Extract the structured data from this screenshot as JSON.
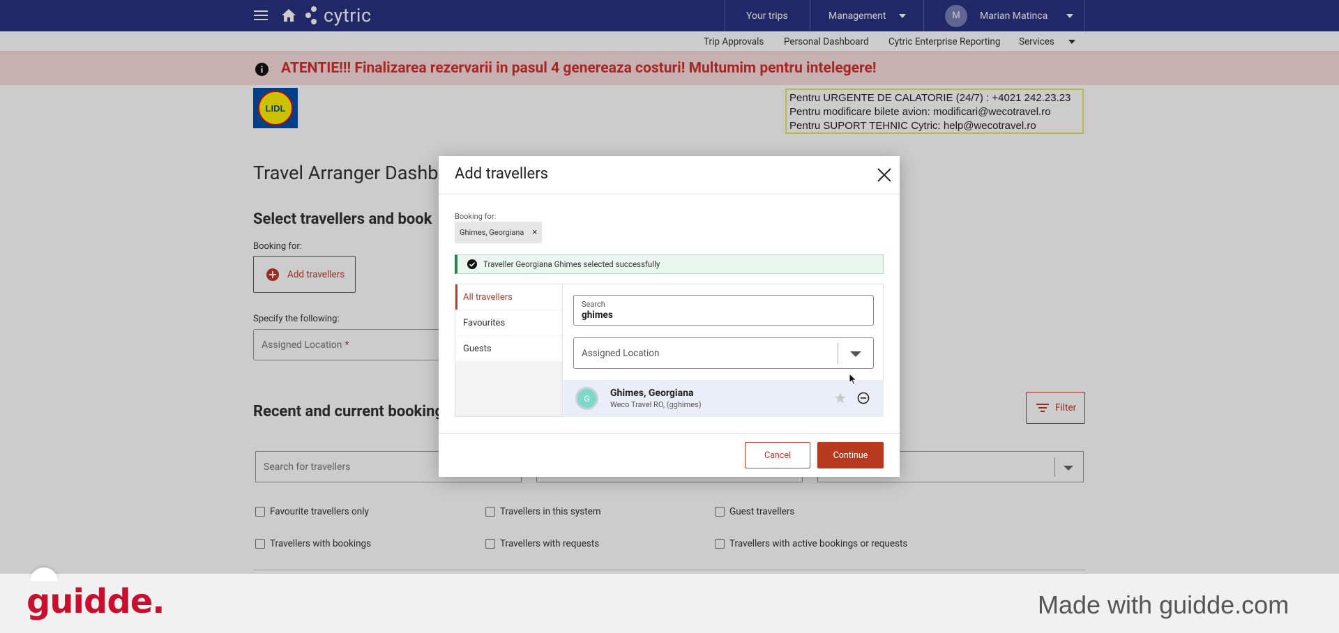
{
  "topbar": {
    "brand": "cytric",
    "your_trips": "Your trips",
    "management": "Management",
    "user_initial": "M",
    "user_name": "Marian Matinca"
  },
  "subnav": {
    "items": [
      "Trip Approvals",
      "Personal Dashboard",
      "Cytric Enterprise Reporting",
      "Services"
    ]
  },
  "banner": {
    "text": "ATENTIE!!! Finalizarea rezervarii in pasul 4 genereaza costuri! Multumim pentru intelegere!"
  },
  "logo_text": "LIDL",
  "contact_lines": [
    "Pentru URGENTE DE CALATORIE (24/7) : +4021 242.23.23",
    "Pentru modificare bilete avion:  modificari@wecotravel.ro",
    "Pentru SUPORT TEHNIC Cytric:  help@wecotravel.ro"
  ],
  "page": {
    "title": "Travel Arranger Dashboard",
    "select_heading": "Select travellers and book",
    "booking_for_label": "Booking for:",
    "add_travellers": "Add travellers",
    "specify_label": "Specify the following:",
    "assigned_location_placeholder": "Assigned Location",
    "required_mark": "*",
    "recent_heading": "Recent and current bookings",
    "filter_label": "Filter",
    "search_travellers_placeholder": "Search for travellers",
    "checkboxes": [
      [
        "Favourite travellers only",
        "Travellers in this system",
        "Guest travellers"
      ],
      [
        "Travellers with bookings",
        "Travellers with requests",
        "Travellers with active bookings or requests"
      ]
    ]
  },
  "modal": {
    "title": "Add travellers",
    "booking_for_label": "Booking for:",
    "chip_name": "Ghimes, Georgiana",
    "chip_remove": "×",
    "success_msg": "Traveller Georgiana Ghimes selected successfully",
    "tabs": [
      "All travellers",
      "Favourites",
      "Guests"
    ],
    "search_label": "Search",
    "search_value": "ghimes",
    "assigned_location": "Assigned Location",
    "result": {
      "initial": "G",
      "name": "Ghimes, Georgiana",
      "sub": "Weco Travel RO, (gghimes)"
    },
    "cancel": "Cancel",
    "continue": "Continue"
  },
  "footer": {
    "brand": "guidde.",
    "made_with": "Made with guidde.com"
  },
  "colors": {
    "topbar": "#293381",
    "accent_red": "#c0392b",
    "banner_bg": "#f9dddd",
    "banner_text": "#d32f2f",
    "continue_bg": "#b73a1f",
    "guidde_red": "#c8102e"
  }
}
